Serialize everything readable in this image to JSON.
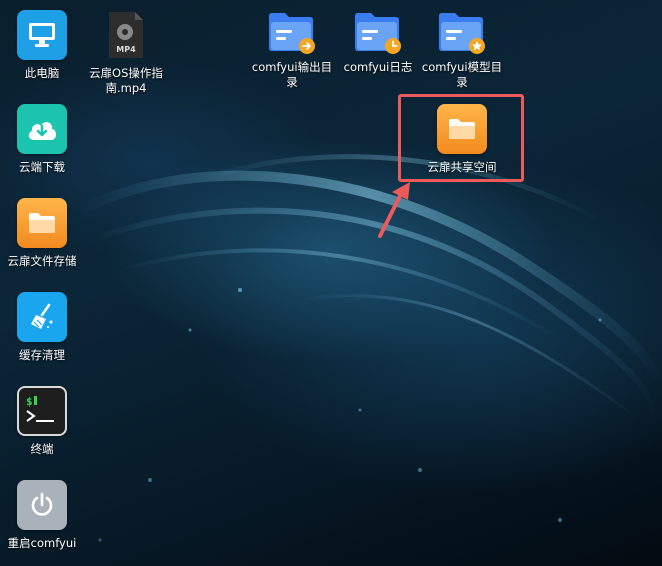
{
  "desktop": {
    "left_column": [
      {
        "label": "此电脑",
        "icon": "monitor-icon"
      },
      {
        "label": "云端下载",
        "icon": "cloud-download-icon"
      },
      {
        "label": "云扉文件存储",
        "icon": "folder-icon"
      },
      {
        "label": "缓存清理",
        "icon": "broom-icon"
      },
      {
        "label": "终端",
        "icon": "terminal-icon"
      },
      {
        "label": "重启comfyui",
        "icon": "power-icon"
      }
    ],
    "video_file": {
      "label": "云扉OS操作指南.mp4",
      "badge": "MP4"
    },
    "folders": [
      {
        "label": "comfyui输出目录",
        "badge": "arrow"
      },
      {
        "label": "comfyui日志",
        "badge": "clock"
      },
      {
        "label": "comfyui模型目录",
        "badge": "star"
      }
    ],
    "highlighted": {
      "label": "云扉共享空间",
      "icon": "folder-icon"
    },
    "terminal_prompt": "$",
    "colors": {
      "monitor_tile": "#1ea0e6",
      "download_tile": "#1cc4b0",
      "folder_tile": "#f59a2c",
      "broom_tile": "#1aa6ee",
      "terminal_tile": "#1e1e1e",
      "power_tile": "#a9b2bb",
      "folder_blue": "#3a7df0",
      "highlight_border": "#ec5a5a"
    }
  }
}
